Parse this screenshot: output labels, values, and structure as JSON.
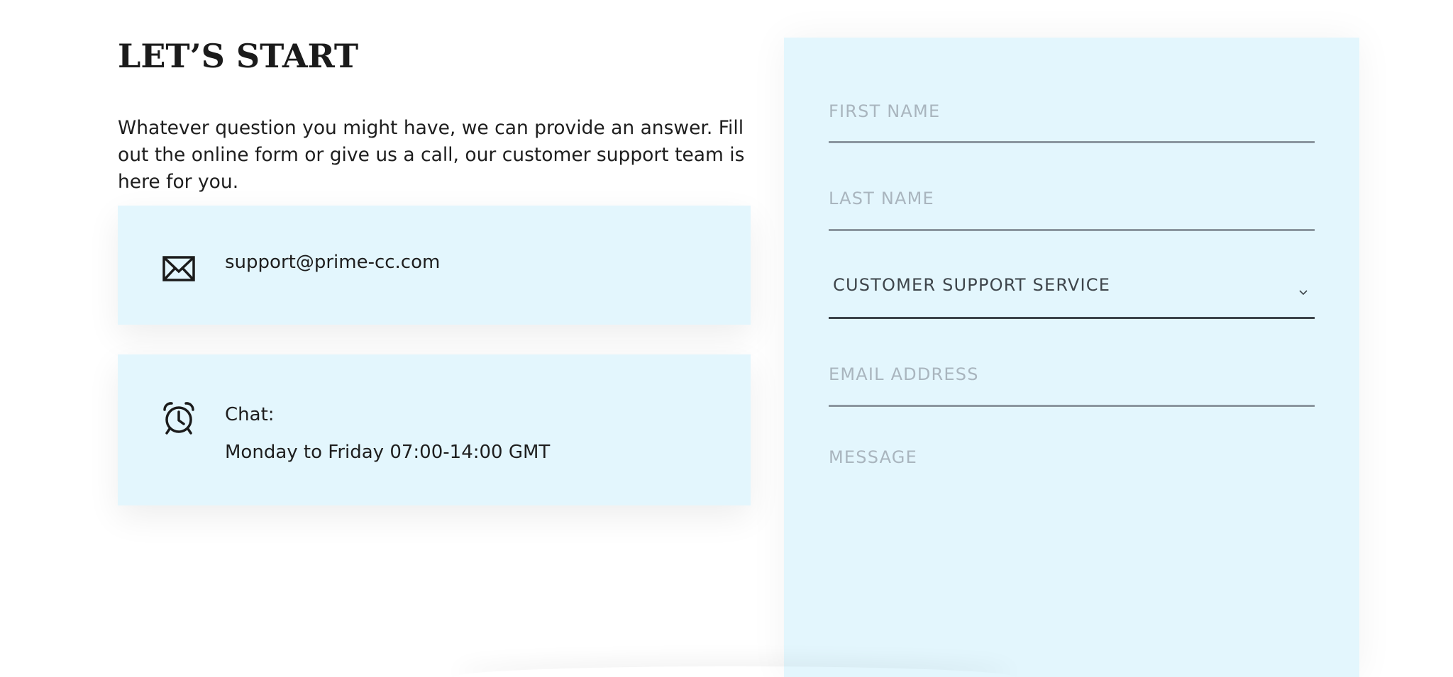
{
  "header": {
    "title": "LET’S START",
    "intro": "Whatever question you might have, we can provide an answer. Fill out the online form or give us a call, our customer support team is here for you."
  },
  "contact_cards": {
    "email": {
      "icon": "envelope-icon",
      "text": "support@prime-cc.com"
    },
    "chat": {
      "icon": "alarm-clock-icon",
      "label": "Chat:",
      "hours": "Monday to Friday 07:00-14:00 GMT"
    }
  },
  "form": {
    "first_name_placeholder": "FIRST NAME",
    "last_name_placeholder": "LAST NAME",
    "department_selected": "CUSTOMER SUPPORT SERVICE",
    "email_placeholder": "EMAIL ADDRESS",
    "message_placeholder": "MESSAGE"
  },
  "colors": {
    "panel_bg": "#e3f6fd",
    "text": "#1e1e1e",
    "placeholder": "#a9b5be",
    "underline": "#8b969f",
    "active_underline": "#3c444b"
  }
}
